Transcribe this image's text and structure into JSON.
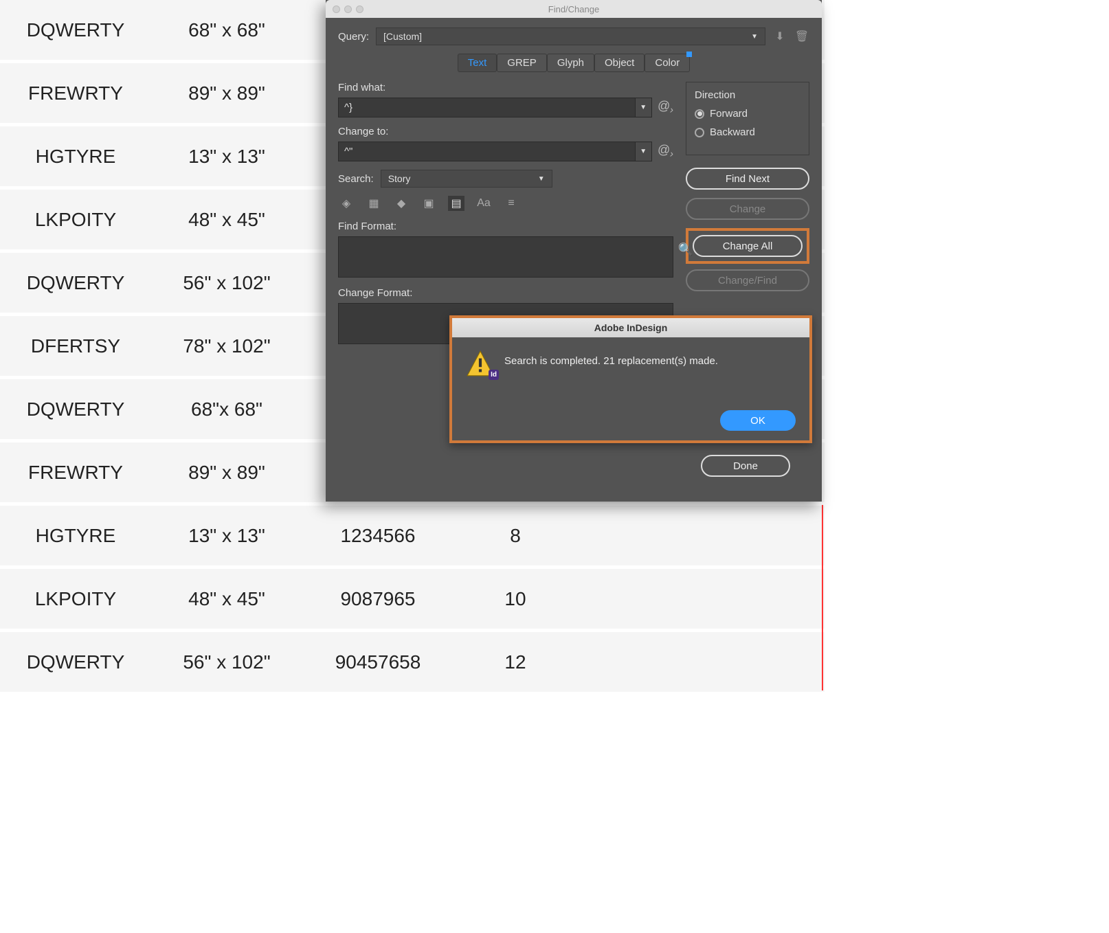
{
  "table": {
    "rows": [
      {
        "c1": "DQWERTY",
        "c2": "68\" x 68\"",
        "c3": "",
        "c4": ""
      },
      {
        "c1": "FREWRTY",
        "c2": "89\" x 89\"",
        "c3": "",
        "c4": ""
      },
      {
        "c1": "HGTYRE",
        "c2": "13\" x 13\"",
        "c3": "",
        "c4": ""
      },
      {
        "c1": "LKPOITY",
        "c2": "48\" x 45\"",
        "c3": "",
        "c4": ""
      },
      {
        "c1": "DQWERTY",
        "c2": "56\" x 102\"",
        "c3": "",
        "c4": ""
      },
      {
        "c1": "DFERTSY",
        "c2": "78\" x 102\"",
        "c3": "",
        "c4": ""
      },
      {
        "c1": "DQWERTY",
        "c2": "68\"x 68\"",
        "c3": "",
        "c4": ""
      },
      {
        "c1": "FREWRTY",
        "c2": "89\" x 89\"",
        "c3": "",
        "c4": ""
      },
      {
        "c1": "HGTYRE",
        "c2": "13\" x 13\"",
        "c3": "1234566",
        "c4": "8"
      },
      {
        "c1": "LKPOITY",
        "c2": "48\" x 45\"",
        "c3": "9087965",
        "c4": "10"
      },
      {
        "c1": "DQWERTY",
        "c2": "56\" x 102\"",
        "c3": "90457658",
        "c4": "12"
      }
    ]
  },
  "panel": {
    "title": "Find/Change",
    "query_label": "Query:",
    "query_value": "[Custom]",
    "tabs": {
      "text": "Text",
      "grep": "GREP",
      "glyph": "Glyph",
      "object": "Object",
      "color": "Color"
    },
    "find_what_label": "Find what:",
    "find_what_value": "^}",
    "change_to_label": "Change to:",
    "change_to_value": "^\"",
    "search_label": "Search:",
    "search_value": "Story",
    "find_format_label": "Find Format:",
    "change_format_label": "Change Format:",
    "direction": {
      "title": "Direction",
      "forward": "Forward",
      "backward": "Backward"
    },
    "buttons": {
      "find_next": "Find Next",
      "change": "Change",
      "change_all": "Change All",
      "change_find": "Change/Find",
      "done": "Done"
    }
  },
  "alert": {
    "title": "Adobe InDesign",
    "message": "Search is completed.  21 replacement(s) made.",
    "ok": "OK",
    "badge": "Id"
  }
}
